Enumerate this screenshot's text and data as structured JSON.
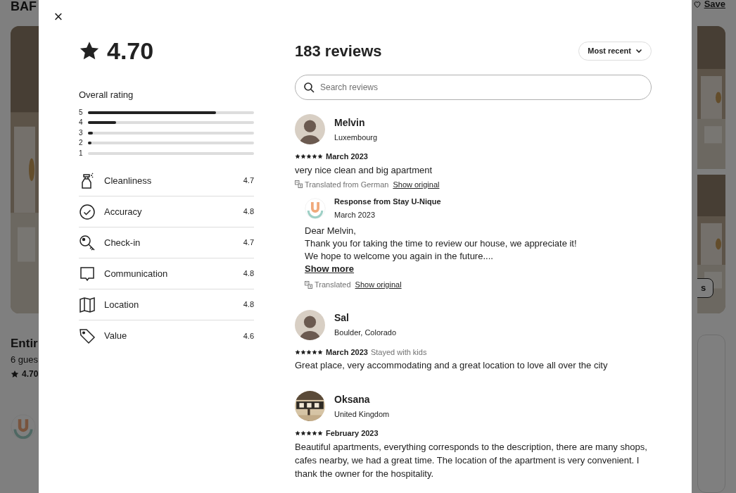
{
  "background": {
    "title": "BAF",
    "save": "Save",
    "photos_button": "s",
    "listing_title": "Entir",
    "guests": "6 gues",
    "rating": "4.70"
  },
  "modal": {
    "close": "×",
    "summary": {
      "rating": "4.70",
      "overall_label": "Overall rating",
      "bars": [
        {
          "label": "5",
          "level": 0.77
        },
        {
          "label": "4",
          "level": 0.17
        },
        {
          "label": "3",
          "level": 0.03
        },
        {
          "label": "2",
          "level": 0.02
        },
        {
          "label": "1",
          "level": 0
        }
      ],
      "categories": [
        {
          "label": "Cleanliness",
          "score": "4.7"
        },
        {
          "label": "Accuracy",
          "score": "4.8"
        },
        {
          "label": "Check-in",
          "score": "4.7"
        },
        {
          "label": "Communication",
          "score": "4.8"
        },
        {
          "label": "Location",
          "score": "4.8"
        },
        {
          "label": "Value",
          "score": "4.6"
        }
      ]
    },
    "reviews_title": "183 reviews",
    "sort": "Most recent",
    "search": {
      "placeholder": "Search reviews"
    },
    "reviews": [
      {
        "name": "Melvin",
        "location": "Luxembourg",
        "avatar": {
          "kind": "person"
        },
        "stars": 5,
        "date": "March 2023",
        "text": "very nice clean and big apartment",
        "translated": "Translated from German",
        "show_original": "Show original",
        "response": {
          "title": "Response from Stay U-Nique",
          "date": "March 2023",
          "lines": [
            "Dear Melvin,",
            "Thank you for taking the time to review our house, we appreciate it!",
            "We hope to welcome you again in the future...."
          ],
          "show_more": "Show more",
          "translated": "Translated",
          "show_original": "Show original"
        }
      },
      {
        "name": "Sal",
        "location": "Boulder, Colorado",
        "avatar": {
          "kind": "person"
        },
        "stars": 5,
        "date": "March 2023",
        "trip": "Stayed with kids",
        "text": "Great place, very accommodating and a great location to love all over the city"
      },
      {
        "name": "Oksana",
        "location": "United Kingdom",
        "stars": 5,
        "date": "February 2023",
        "text": "Beautiful apartments, everything corresponds to the description, there are many shops, cafes nearby, we had a great time. The location of the apartment is very convenient. I thank the owner for the hospitality."
      }
    ]
  }
}
